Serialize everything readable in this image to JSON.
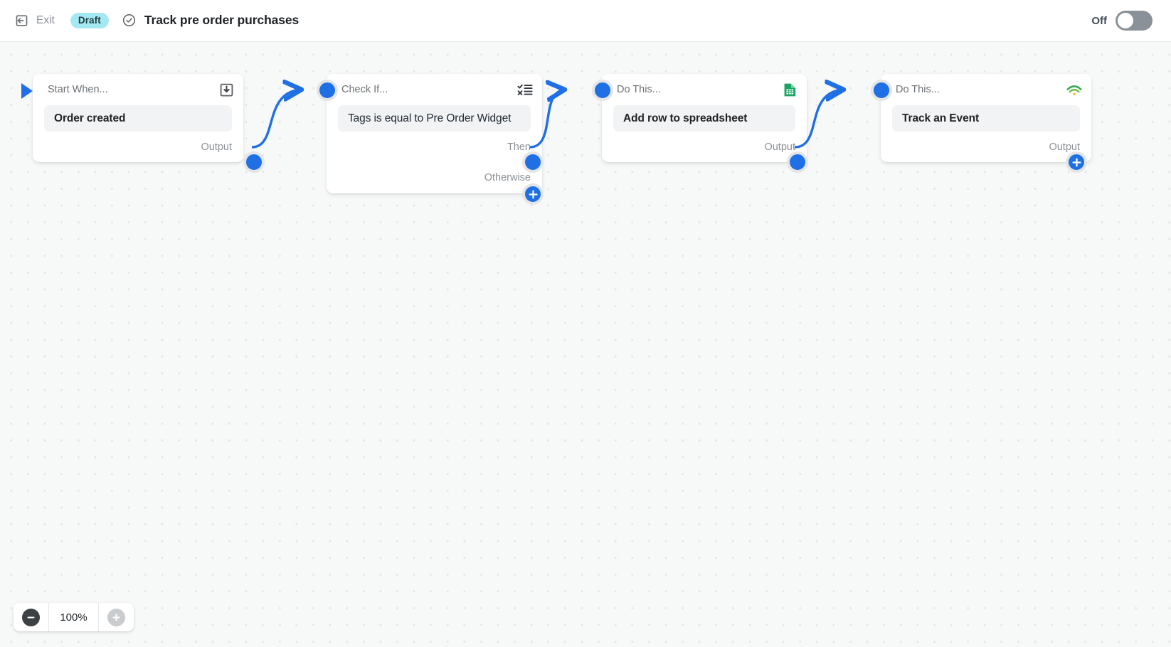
{
  "header": {
    "exit_label": "Exit",
    "exit_icon": "exit-arrow-icon",
    "status_badge": "Draft",
    "check_icon": "check-circle-icon",
    "title": "Track pre order purchases",
    "toggle_label": "Off",
    "toggle_state": "off",
    "accent_color": "#1f6fe5",
    "badge_color": "#a4e8f2"
  },
  "canvas": {
    "background": "#f7f8f8",
    "grid": "dots"
  },
  "nodes": [
    {
      "id": "trigger",
      "head": "Start When...",
      "icon": "inbox-download-icon",
      "icon_color": "#5c5f62",
      "content": "Order created",
      "content_bold": true,
      "ports": [
        "Output"
      ]
    },
    {
      "id": "condition",
      "head": "Check If...",
      "icon": "condition-rules-icon",
      "icon_color": "#31373d",
      "content": "Tags is equal to Pre Order Widget",
      "content_bold": false,
      "ports": [
        "Then",
        "Otherwise"
      ]
    },
    {
      "id": "action-sheets",
      "head": "Do This...",
      "icon": "google-sheets-icon",
      "icon_color": "#0f9d58",
      "content": "Add row to spreadsheet",
      "content_bold": true,
      "ports": [
        "Output"
      ]
    },
    {
      "id": "action-track",
      "head": "Do This...",
      "icon": "signal-wifi-icon",
      "icon_color": "#34a853",
      "content": "Track an Event",
      "content_bold": true,
      "ports": [
        "Output"
      ]
    }
  ],
  "zoom_controls": {
    "zoom_out_icon": "minus-icon",
    "zoom_in_icon": "plus-icon",
    "level": "100%"
  }
}
